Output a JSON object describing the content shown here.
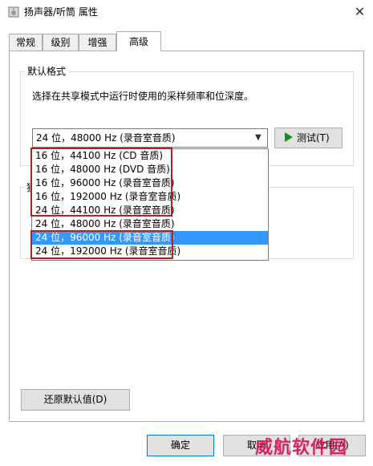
{
  "window": {
    "title": "扬声器/听筒 属性",
    "close_glyph": "✕"
  },
  "tabs": [
    {
      "label": "常规"
    },
    {
      "label": "级别"
    },
    {
      "label": "增强"
    },
    {
      "label": "高级"
    }
  ],
  "default_format": {
    "group_label": "默认格式",
    "description": "选择在共享模式中运行时使用的采样频率和位深度。",
    "selected_value": "24 位，48000 Hz (录音室音质)",
    "test_button": "▶ 测试(T)",
    "test_label": "测试(T)"
  },
  "exclusive_group_label": "独",
  "dropdown_options": [
    "16 位，44100 Hz (CD 音质)",
    "16 位，48000 Hz (DVD 音质)",
    "16 位，96000 Hz (录音室音质)",
    "16 位，192000 Hz (录音室音质)",
    "24 位，44100 Hz (录音室音质)",
    "24 位，48000 Hz (录音室音质)",
    "24 位，96000 Hz (录音室音质)",
    "24 位，192000 Hz (录音室音质)"
  ],
  "selected_option_index": 6,
  "buttons": {
    "restore_defaults": "还原默认值(D)",
    "ok": "确定",
    "cancel": "取消",
    "apply": "应用(A)"
  },
  "watermark": "威航软件园",
  "colors": {
    "selection": "#3399ff",
    "highlight_box": "#b22222",
    "watermark": "#d4145a"
  }
}
